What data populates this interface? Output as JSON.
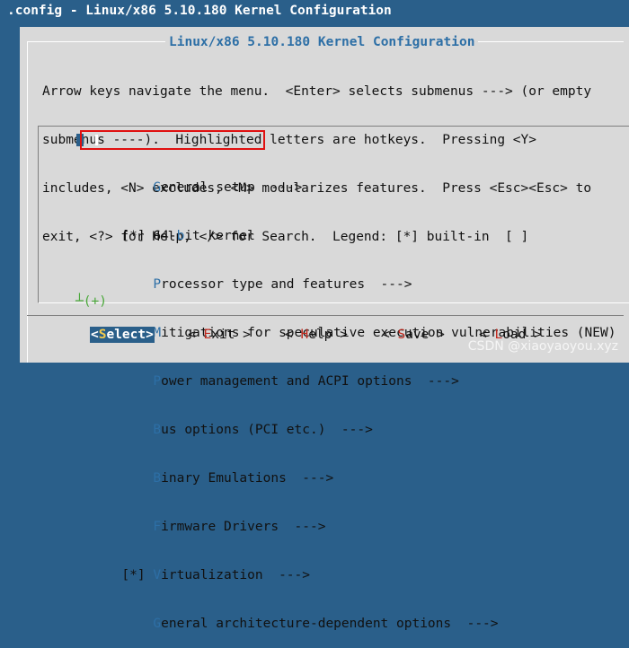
{
  "window": {
    "title": ".config - Linux/x86 5.10.180 Kernel Configuration"
  },
  "dialog": {
    "title": "Linux/x86 5.10.180 Kernel Configuration",
    "help_lines": [
      "Arrow keys navigate the menu.  <Enter> selects submenus ---> (or empty",
      "submenus ----).  Highlighted letters are hotkeys.  Pressing <Y>",
      "includes, <N> excludes, <M> modularizes features.  Press <Esc><Esc> to",
      "exit, <?> for Help, </> for Search.  Legend: [*] built-in  [ ]"
    ]
  },
  "menu": {
    "items": [
      {
        "prefix": "",
        "hotkey": "G",
        "rest": "eneral setup  --->",
        "selected": true
      },
      {
        "prefix": "[*]",
        "before": "64-",
        "hotkey": "b",
        "rest": "it kernel"
      },
      {
        "prefix": "",
        "hotkey": "P",
        "rest": "rocessor type and features  --->"
      },
      {
        "prefix": "[*]",
        "hotkey": "M",
        "rest": "itigations for speculative execution vulnerabilities (NEW)"
      },
      {
        "prefix": "",
        "hotkey": "P",
        "rest": "ower management and ACPI options  --->"
      },
      {
        "prefix": "",
        "hotkey": "B",
        "rest": "us options (PCI etc.)  --->"
      },
      {
        "prefix": "",
        "hotkey": "B",
        "rest": "inary Emulations  --->"
      },
      {
        "prefix": "",
        "hotkey": "F",
        "rest": "irmware Drivers  --->"
      },
      {
        "prefix": "[*]",
        "hotkey": "V",
        "rest": "irtualization  --->"
      },
      {
        "prefix": "",
        "hotkey": "G",
        "rest": "eneral architecture-dependent options  --->"
      }
    ],
    "more_indicator": "┴(+)"
  },
  "buttons": {
    "select": {
      "open": "<",
      "hotkey": "S",
      "rest": "elect",
      "close": ">"
    },
    "exit": {
      "open": "< ",
      "hotkey": "E",
      "rest": "xit",
      "close": " >"
    },
    "help": {
      "open": "< ",
      "hotkey": "H",
      "rest": "elp",
      "close": " >"
    },
    "save": {
      "open": "< ",
      "hotkey": "S",
      "rest": "ave",
      "close": " >"
    },
    "load": {
      "open": "< ",
      "hotkey": "L",
      "rest": "oad",
      "close": " >"
    }
  },
  "watermark": "CSDN @xiaoyaoyou.xyz",
  "colors": {
    "background": "#2a5f8a",
    "dialog": "#d9d9d9",
    "hotkey": "#2d6fa6",
    "button_hotkey": "#c0281d",
    "annotation_box": "#e01010"
  }
}
